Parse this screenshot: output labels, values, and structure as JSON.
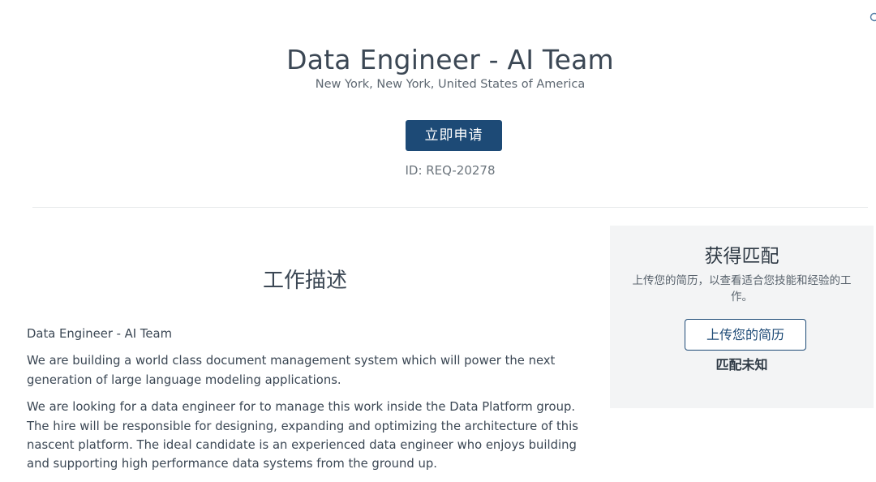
{
  "job": {
    "title": "Data Engineer - AI Team",
    "location": "New York, New York, United States of America",
    "apply_label": "立即申请",
    "id_text": "ID: REQ-20278"
  },
  "description": {
    "heading": "工作描述",
    "paragraphs": [
      "Data Engineer - AI Team",
      "We are building a world class document management system which will power the next generation of large language modeling applications.",
      "We are looking for a data engineer for to manage this work inside the Data Platform group. The hire will be responsible for designing, expanding and optimizing the architecture of this nascent platform. The ideal candidate is an experienced data engineer who enjoys building and supporting high performance data systems from the ground up."
    ]
  },
  "match": {
    "title": "获得匹配",
    "description": "上传您的简历，以查看适合您技能和经验的工作。",
    "upload_label": "上传您的简历",
    "status": "匹配未知"
  },
  "icons": {
    "corner": "search-icon"
  },
  "colors": {
    "primary": "#1d4a76",
    "panel_bg": "#f3f4f5",
    "text": "#3b4754"
  }
}
